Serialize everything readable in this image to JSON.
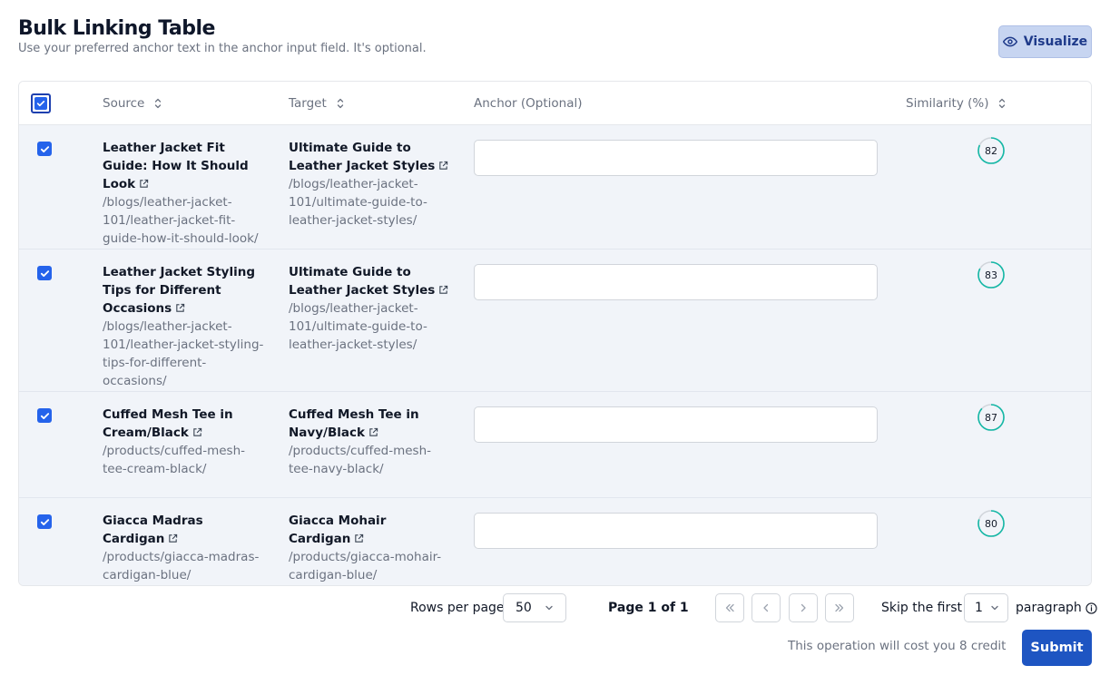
{
  "header": {
    "title": "Bulk Linking Table",
    "subtitle": "Use your preferred anchor text in the anchor input field. It's optional.",
    "visualize_label": "Visualize"
  },
  "table": {
    "columns": {
      "source": "Source",
      "target": "Target",
      "anchor": "Anchor (Optional)",
      "similarity": "Similarity (%)"
    },
    "rows": [
      {
        "source_title": "Leather Jacket Fit Guide: How It Should Look",
        "source_path": "/blogs/leather-jacket-101/leather-jacket-fit-guide-how-it-should-look/",
        "target_title": "Ultimate Guide to Leather Jacket Styles",
        "target_path": "/blogs/leather-jacket-101/ultimate-guide-to-leather-jacket-styles/",
        "anchor_value": "",
        "similarity": "82",
        "checked": true
      },
      {
        "source_title": "Leather Jacket Styling Tips for Different Occasions",
        "source_path": "/blogs/leather-jacket-101/leather-jacket-styling-tips-for-different-occasions/",
        "target_title": "Ultimate Guide to Leather Jacket Styles",
        "target_path": "/blogs/leather-jacket-101/ultimate-guide-to-leather-jacket-styles/",
        "anchor_value": "",
        "similarity": "83",
        "checked": true
      },
      {
        "source_title": "Cuffed Mesh Tee in Cream/Black",
        "source_path": "/products/cuffed-mesh-tee-cream-black/",
        "target_title": "Cuffed Mesh Tee in Navy/Black",
        "target_path": "/products/cuffed-mesh-tee-navy-black/",
        "anchor_value": "",
        "similarity": "87",
        "checked": true
      },
      {
        "source_title": "Giacca Madras Cardigan",
        "source_path": "/products/giacca-madras-cardigan-blue/",
        "target_title": "Giacca Mohair Cardigan",
        "target_path": "/products/giacca-mohair-cardigan-blue/",
        "anchor_value": "",
        "similarity": "80",
        "checked": true
      }
    ]
  },
  "pagination": {
    "rows_per_page_label": "Rows per page",
    "rows_per_page_value": "50",
    "page_label": "Page 1 of 1",
    "skip_label": "Skip the first",
    "skip_value": "1",
    "paragraph_label": "paragraph"
  },
  "footer": {
    "cost_text": "This operation will cost you 8 credit",
    "submit_label": "Submit"
  },
  "colors": {
    "accent": "#2563eb",
    "ring": "#14b8a6",
    "row_bg": "#f1f4f9"
  }
}
